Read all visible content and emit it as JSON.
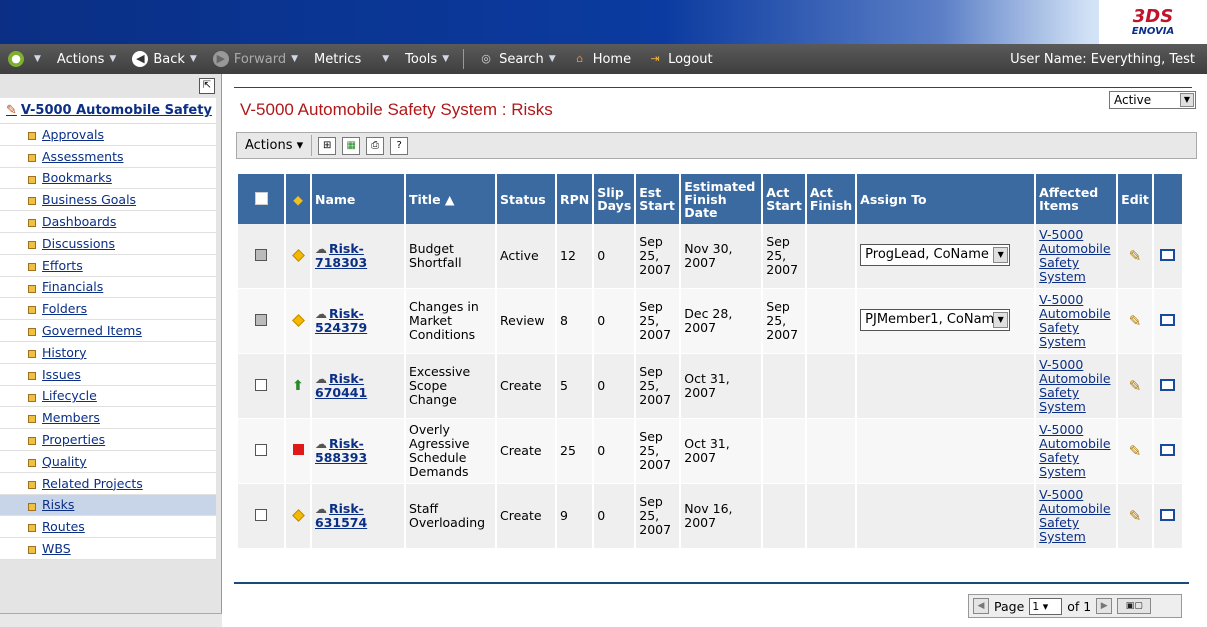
{
  "logo": {
    "brand": "3DS",
    "product": "ENOVIA"
  },
  "toolbar": {
    "actions": "Actions",
    "back": "Back",
    "forward": "Forward",
    "metrics": "Metrics",
    "tools": "Tools",
    "search": "Search",
    "home": "Home",
    "logout": "Logout",
    "user": "User Name: Everything, Test"
  },
  "sidebar": {
    "root": "V-5000 Automobile Safety",
    "items": [
      {
        "label": "Approvals"
      },
      {
        "label": "Assessments"
      },
      {
        "label": "Bookmarks"
      },
      {
        "label": "Business Goals"
      },
      {
        "label": "Dashboards"
      },
      {
        "label": "Discussions"
      },
      {
        "label": "Efforts"
      },
      {
        "label": "Financials"
      },
      {
        "label": "Folders"
      },
      {
        "label": "Governed Items"
      },
      {
        "label": "History"
      },
      {
        "label": "Issues"
      },
      {
        "label": "Lifecycle"
      },
      {
        "label": "Members"
      },
      {
        "label": "Properties"
      },
      {
        "label": "Quality"
      },
      {
        "label": "Related Projects"
      },
      {
        "label": "Risks"
      },
      {
        "label": "Routes"
      },
      {
        "label": "WBS"
      }
    ],
    "selected": "Risks"
  },
  "page": {
    "title": "V-5000 Automobile Safety System : Risks",
    "filter": "Active",
    "actions": "Actions"
  },
  "table": {
    "headers": {
      "name": "Name",
      "title": "Title ▲",
      "status": "Status",
      "rpn": "RPN",
      "slip": "Slip Days",
      "est_start": "Est Start",
      "est_finish": "Estimated Finish Date",
      "act_start": "Act Start",
      "act_finish": "Act Finish",
      "assign": "Assign To",
      "affected": "Affected Items",
      "edit": "Edit"
    },
    "rows": [
      {
        "priority": "medium",
        "name": "Risk-718303",
        "title": "Budget Shortfall",
        "status": "Active",
        "rpn": "12",
        "slip": "0",
        "est_start": "Sep 25, 2007",
        "est_finish": "Nov 30, 2007",
        "act_start": "Sep 25, 2007",
        "act_finish": "",
        "assign": "ProgLead, CoName",
        "affected": "V-5000 Automobile Safety System",
        "disabled": true
      },
      {
        "priority": "medium",
        "name": "Risk-524379",
        "title": "Changes in Market Conditions",
        "status": "Review",
        "rpn": "8",
        "slip": "0",
        "est_start": "Sep 25, 2007",
        "est_finish": "Dec 28, 2007",
        "act_start": "Sep 25, 2007",
        "act_finish": "",
        "assign": "PJMember1, CoName",
        "affected": "V-5000 Automobile Safety System",
        "disabled": true
      },
      {
        "priority": "low",
        "name": "Risk-670441",
        "title": "Excessive Scope Change",
        "status": "Create",
        "rpn": "5",
        "slip": "0",
        "est_start": "Sep 25, 2007",
        "est_finish": "Oct 31, 2007",
        "act_start": "",
        "act_finish": "",
        "assign": "",
        "affected": "V-5000 Automobile Safety System",
        "disabled": false
      },
      {
        "priority": "high",
        "name": "Risk-588393",
        "title": "Overly Agressive Schedule Demands",
        "status": "Create",
        "rpn": "25",
        "slip": "0",
        "est_start": "Sep 25, 2007",
        "est_finish": "Oct 31, 2007",
        "act_start": "",
        "act_finish": "",
        "assign": "",
        "affected": "V-5000 Automobile Safety System",
        "disabled": false
      },
      {
        "priority": "medium",
        "name": "Risk-631574",
        "title": "Staff Overloading",
        "status": "Create",
        "rpn": "9",
        "slip": "0",
        "est_start": "Sep 25, 2007",
        "est_finish": "Nov 16, 2007",
        "act_start": "",
        "act_finish": "",
        "assign": "",
        "affected": "V-5000 Automobile Safety System",
        "disabled": false
      }
    ]
  },
  "pager": {
    "page_label": "Page",
    "page": "1",
    "of_label": "of 1"
  }
}
